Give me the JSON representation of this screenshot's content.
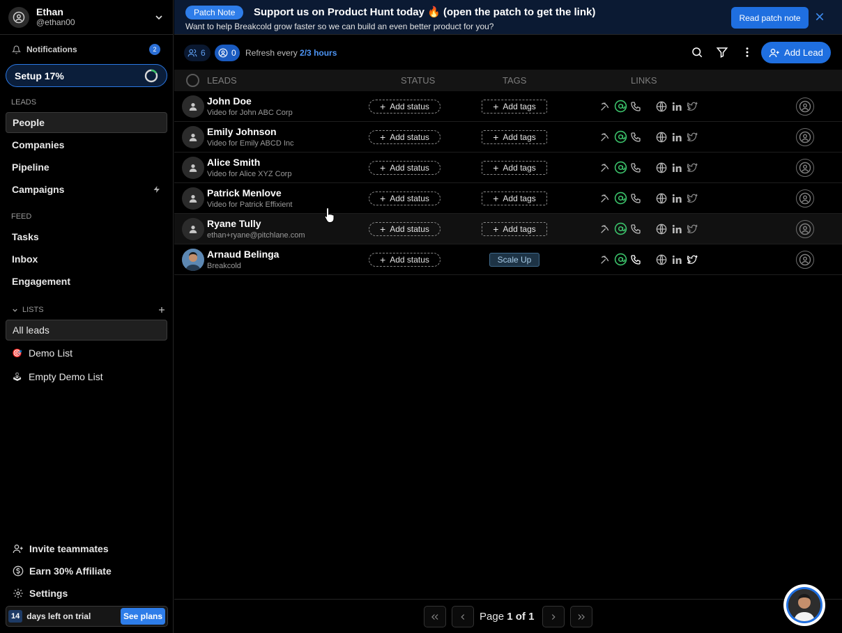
{
  "user": {
    "name": "Ethan",
    "handle": "@ethan00"
  },
  "sidebar": {
    "notifications": {
      "label": "Notifications",
      "count": "2"
    },
    "setup": {
      "label": "Setup 17%",
      "progress": 0.17
    },
    "leads_title": "LEADS",
    "leads_items": [
      {
        "label": "People"
      },
      {
        "label": "Companies"
      },
      {
        "label": "Pipeline"
      },
      {
        "label": "Campaigns"
      }
    ],
    "feed_title": "FEED",
    "feed_items": [
      {
        "label": "Tasks"
      },
      {
        "label": "Inbox"
      },
      {
        "label": "Engagement"
      }
    ],
    "lists_title": "LISTS",
    "lists": [
      {
        "label": "All leads"
      },
      {
        "label": "Demo List",
        "emoji": "🎯"
      },
      {
        "label": "Empty Demo List",
        "emoji": "🕹"
      }
    ],
    "bottom": {
      "invite": "Invite teammates",
      "affiliate": "Earn 30% Affiliate",
      "settings": "Settings"
    },
    "trial": {
      "days": "14",
      "text": "days left on trial",
      "cta": "See plans"
    }
  },
  "banner": {
    "pill": "Patch Note",
    "title": "Support us on Product Hunt today 🔥 (open the patch to get the link)",
    "subtitle": "Want to help Breakcold grow faster so we can build an even better product for you?",
    "cta": "Read patch note"
  },
  "toolbar": {
    "people_count": "6",
    "owner_count": "0",
    "refresh_prefix": "Refresh every",
    "refresh_value": "2/3 hours",
    "add_lead": "Add Lead"
  },
  "table": {
    "headers": {
      "leads": "LEADS",
      "status": "STATUS",
      "tags": "TAGS",
      "links": "LINKS"
    },
    "add_status": "Add status",
    "add_tags": "Add tags",
    "rows": [
      {
        "name": "John Doe",
        "sub": "Video for John ABC Corp",
        "tag": ""
      },
      {
        "name": "Emily Johnson",
        "sub": "Video for Emily ABCD Inc",
        "tag": ""
      },
      {
        "name": "Alice Smith",
        "sub": "Video for Alice XYZ Corp",
        "tag": ""
      },
      {
        "name": "Patrick Menlove",
        "sub": "Video for Patrick Effixient",
        "tag": ""
      },
      {
        "name": "Ryane Tully",
        "sub": "ethan+ryane@pitchlane.com",
        "tag": ""
      },
      {
        "name": "Arnaud Belinga",
        "sub": "Breakcold",
        "tag": "Scale Up"
      }
    ]
  },
  "pagination": {
    "prefix": "Page",
    "current": "1",
    "of": "of",
    "total": "1"
  },
  "colors": {
    "accent": "#1f6fe0",
    "background": "#000000",
    "link_green": "#3cc36b"
  }
}
